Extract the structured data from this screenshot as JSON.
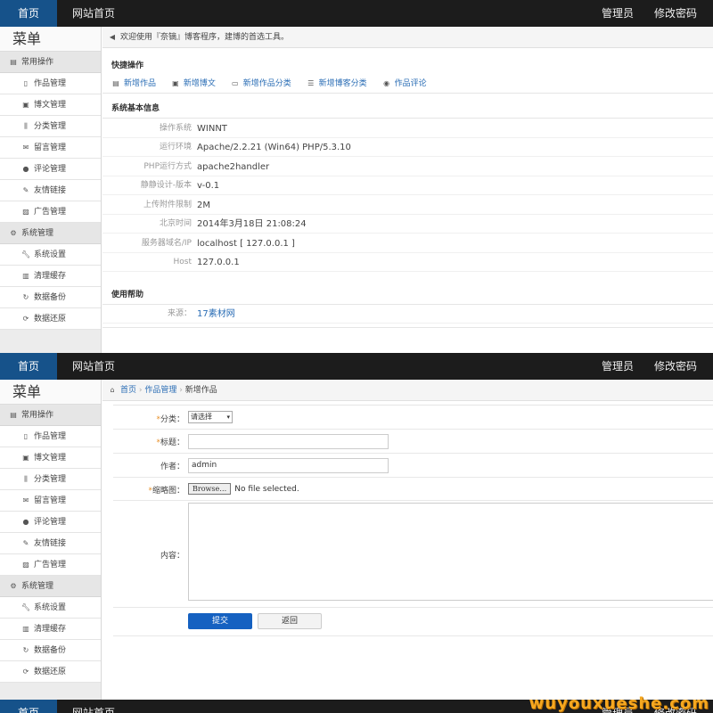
{
  "topbar": {
    "home": "首页",
    "site_home": "网站首页",
    "admin": "管理员",
    "change_password": "修改密码"
  },
  "sidebar": {
    "title": "菜单",
    "groups": [
      {
        "label": "常用操作",
        "icon": "list-icon",
        "items": [
          {
            "label": "作品管理",
            "icon": "file-icon"
          },
          {
            "label": "博文管理",
            "icon": "document-icon"
          },
          {
            "label": "分类管理",
            "icon": "books-icon"
          },
          {
            "label": "留言管理",
            "icon": "mail-icon"
          },
          {
            "label": "评论管理",
            "icon": "comment-icon"
          },
          {
            "label": "友情链接",
            "icon": "link-icon"
          },
          {
            "label": "广告管理",
            "icon": "picture-icon"
          }
        ]
      },
      {
        "label": "系统管理",
        "icon": "gear-icon",
        "items": [
          {
            "label": "系统设置",
            "icon": "wrench-icon"
          },
          {
            "label": "清理缓存",
            "icon": "trash-icon"
          },
          {
            "label": "数据备份",
            "icon": "refresh-icon"
          },
          {
            "label": "数据还原",
            "icon": "restore-icon"
          }
        ]
      }
    ]
  },
  "dashboard": {
    "notice": "欢迎使用『奈镝』博客程序，建博的首选工具。",
    "quick_title": "快捷操作",
    "quick_links": [
      {
        "label": "新增作品",
        "icon": "list-icon"
      },
      {
        "label": "新增博文",
        "icon": "document-icon"
      },
      {
        "label": "新增作品分类",
        "icon": "folder-icon"
      },
      {
        "label": "新增博客分类",
        "icon": "list-icon"
      },
      {
        "label": "作品评论",
        "icon": "comment-icon"
      }
    ],
    "info_title": "系统基本信息",
    "info": [
      {
        "label": "操作系统",
        "value": "WINNT"
      },
      {
        "label": "运行环境",
        "value": "Apache/2.2.21 (Win64) PHP/5.3.10"
      },
      {
        "label": "PHP运行方式",
        "value": "apache2handler"
      },
      {
        "label": "静静设计-版本",
        "value": "v-0.1"
      },
      {
        "label": "上传附件限制",
        "value": "2M"
      },
      {
        "label": "北京时间",
        "value": "2014年3月18日 21:08:24"
      },
      {
        "label": "服务器域名/IP",
        "value": "localhost [ 127.0.0.1 ]"
      },
      {
        "label": "Host",
        "value": "127.0.0.1"
      }
    ],
    "help_title": "使用帮助",
    "source_label": "来源：",
    "source_value": "17素材网"
  },
  "form_page": {
    "breadcrumb": [
      "首页",
      "作品管理",
      "新增作品"
    ],
    "category_label": "分类：",
    "category_value": "请选择",
    "title_label": "标题：",
    "title_value": "",
    "author_label": "作者：",
    "author_value": "admin",
    "thumb_label": "缩略图：",
    "browse_label": "Browse…",
    "file_status": "No file selected.",
    "content_label": "内容：",
    "submit_label": "提交",
    "back_label": "返回"
  },
  "watermark": "wuyouxueshe.com"
}
